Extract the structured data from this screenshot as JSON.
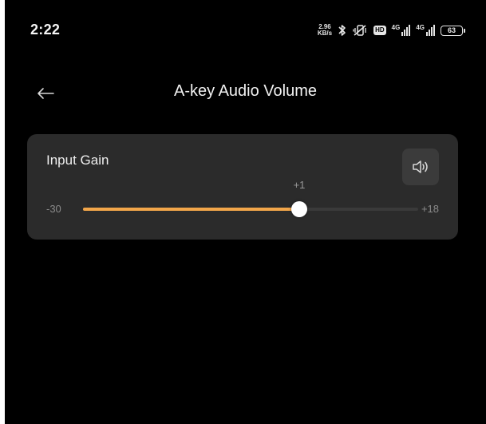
{
  "status_bar": {
    "time": "2:22",
    "net_speed_value": "2.96",
    "net_speed_unit": "KB/s",
    "hd_badge": "HD",
    "signal_1_label": "4G",
    "signal_2_label": "4G",
    "battery_level": "63"
  },
  "header": {
    "back_icon": "arrow-left-icon",
    "title": "A-key Audio Volume"
  },
  "input_gain": {
    "label": "Input Gain",
    "speaker_icon": "speaker-icon",
    "value_label": "+1",
    "value": 1,
    "min_label": "-30",
    "max_label": "+18",
    "min": -30,
    "max": 18
  },
  "colors": {
    "accent": "#f2a64a",
    "background": "#000000",
    "card": "#2b2b2b",
    "speaker_button": "#3b3b3b"
  }
}
